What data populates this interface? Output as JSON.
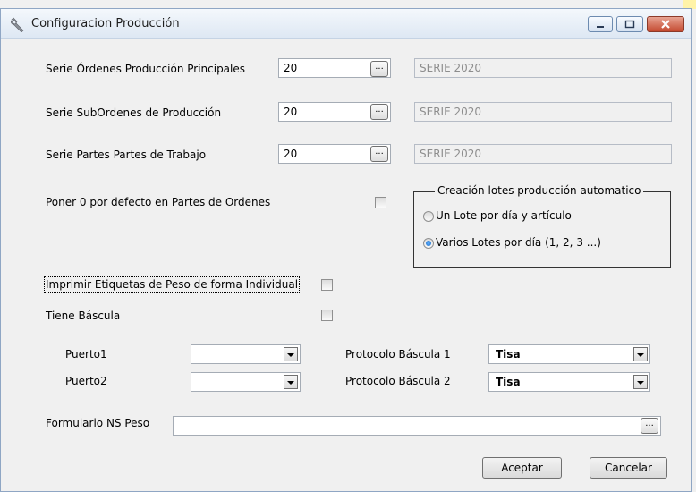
{
  "window": {
    "title": "Configuracion  Producción"
  },
  "series": [
    {
      "label": "Serie Órdenes Producción Principales",
      "value": "20",
      "button": "...",
      "description": "SERIE 2020"
    },
    {
      "label": "Serie SubOrdenes de Producción",
      "value": "20",
      "button": "...",
      "description": "SERIE 2020"
    },
    {
      "label": "Serie Partes Partes de Trabajo",
      "value": "20",
      "button": "...",
      "description": "SERIE 2020"
    }
  ],
  "poner_cero": {
    "label": "Poner 0 por defecto en Partes de Ordenes",
    "checked": false
  },
  "lotes_group": {
    "title": "Creación lotes producción automatico",
    "options": [
      {
        "label": "Un Lote por día y artículo",
        "checked": false
      },
      {
        "label": "Varios Lotes por día (1, 2, 3 ...)",
        "checked": true
      }
    ]
  },
  "imprimir_etiquetas": {
    "label": "Imprimir Etiquetas de Peso de forma Individual",
    "checked": false
  },
  "tiene_bascula": {
    "label": "Tiene Báscula",
    "checked": false
  },
  "puerto1": {
    "label": "Puerto1",
    "value": ""
  },
  "puerto2": {
    "label": "Puerto2",
    "value": ""
  },
  "protocolo1": {
    "label": "Protocolo Báscula 1",
    "value": "Tisa"
  },
  "protocolo2": {
    "label": "Protocolo Báscula 2",
    "value": "Tisa"
  },
  "formulario": {
    "label": "Formulario NS Peso",
    "value": "",
    "button": "..."
  },
  "buttons": {
    "accept": "Aceptar",
    "cancel": "Cancelar"
  }
}
